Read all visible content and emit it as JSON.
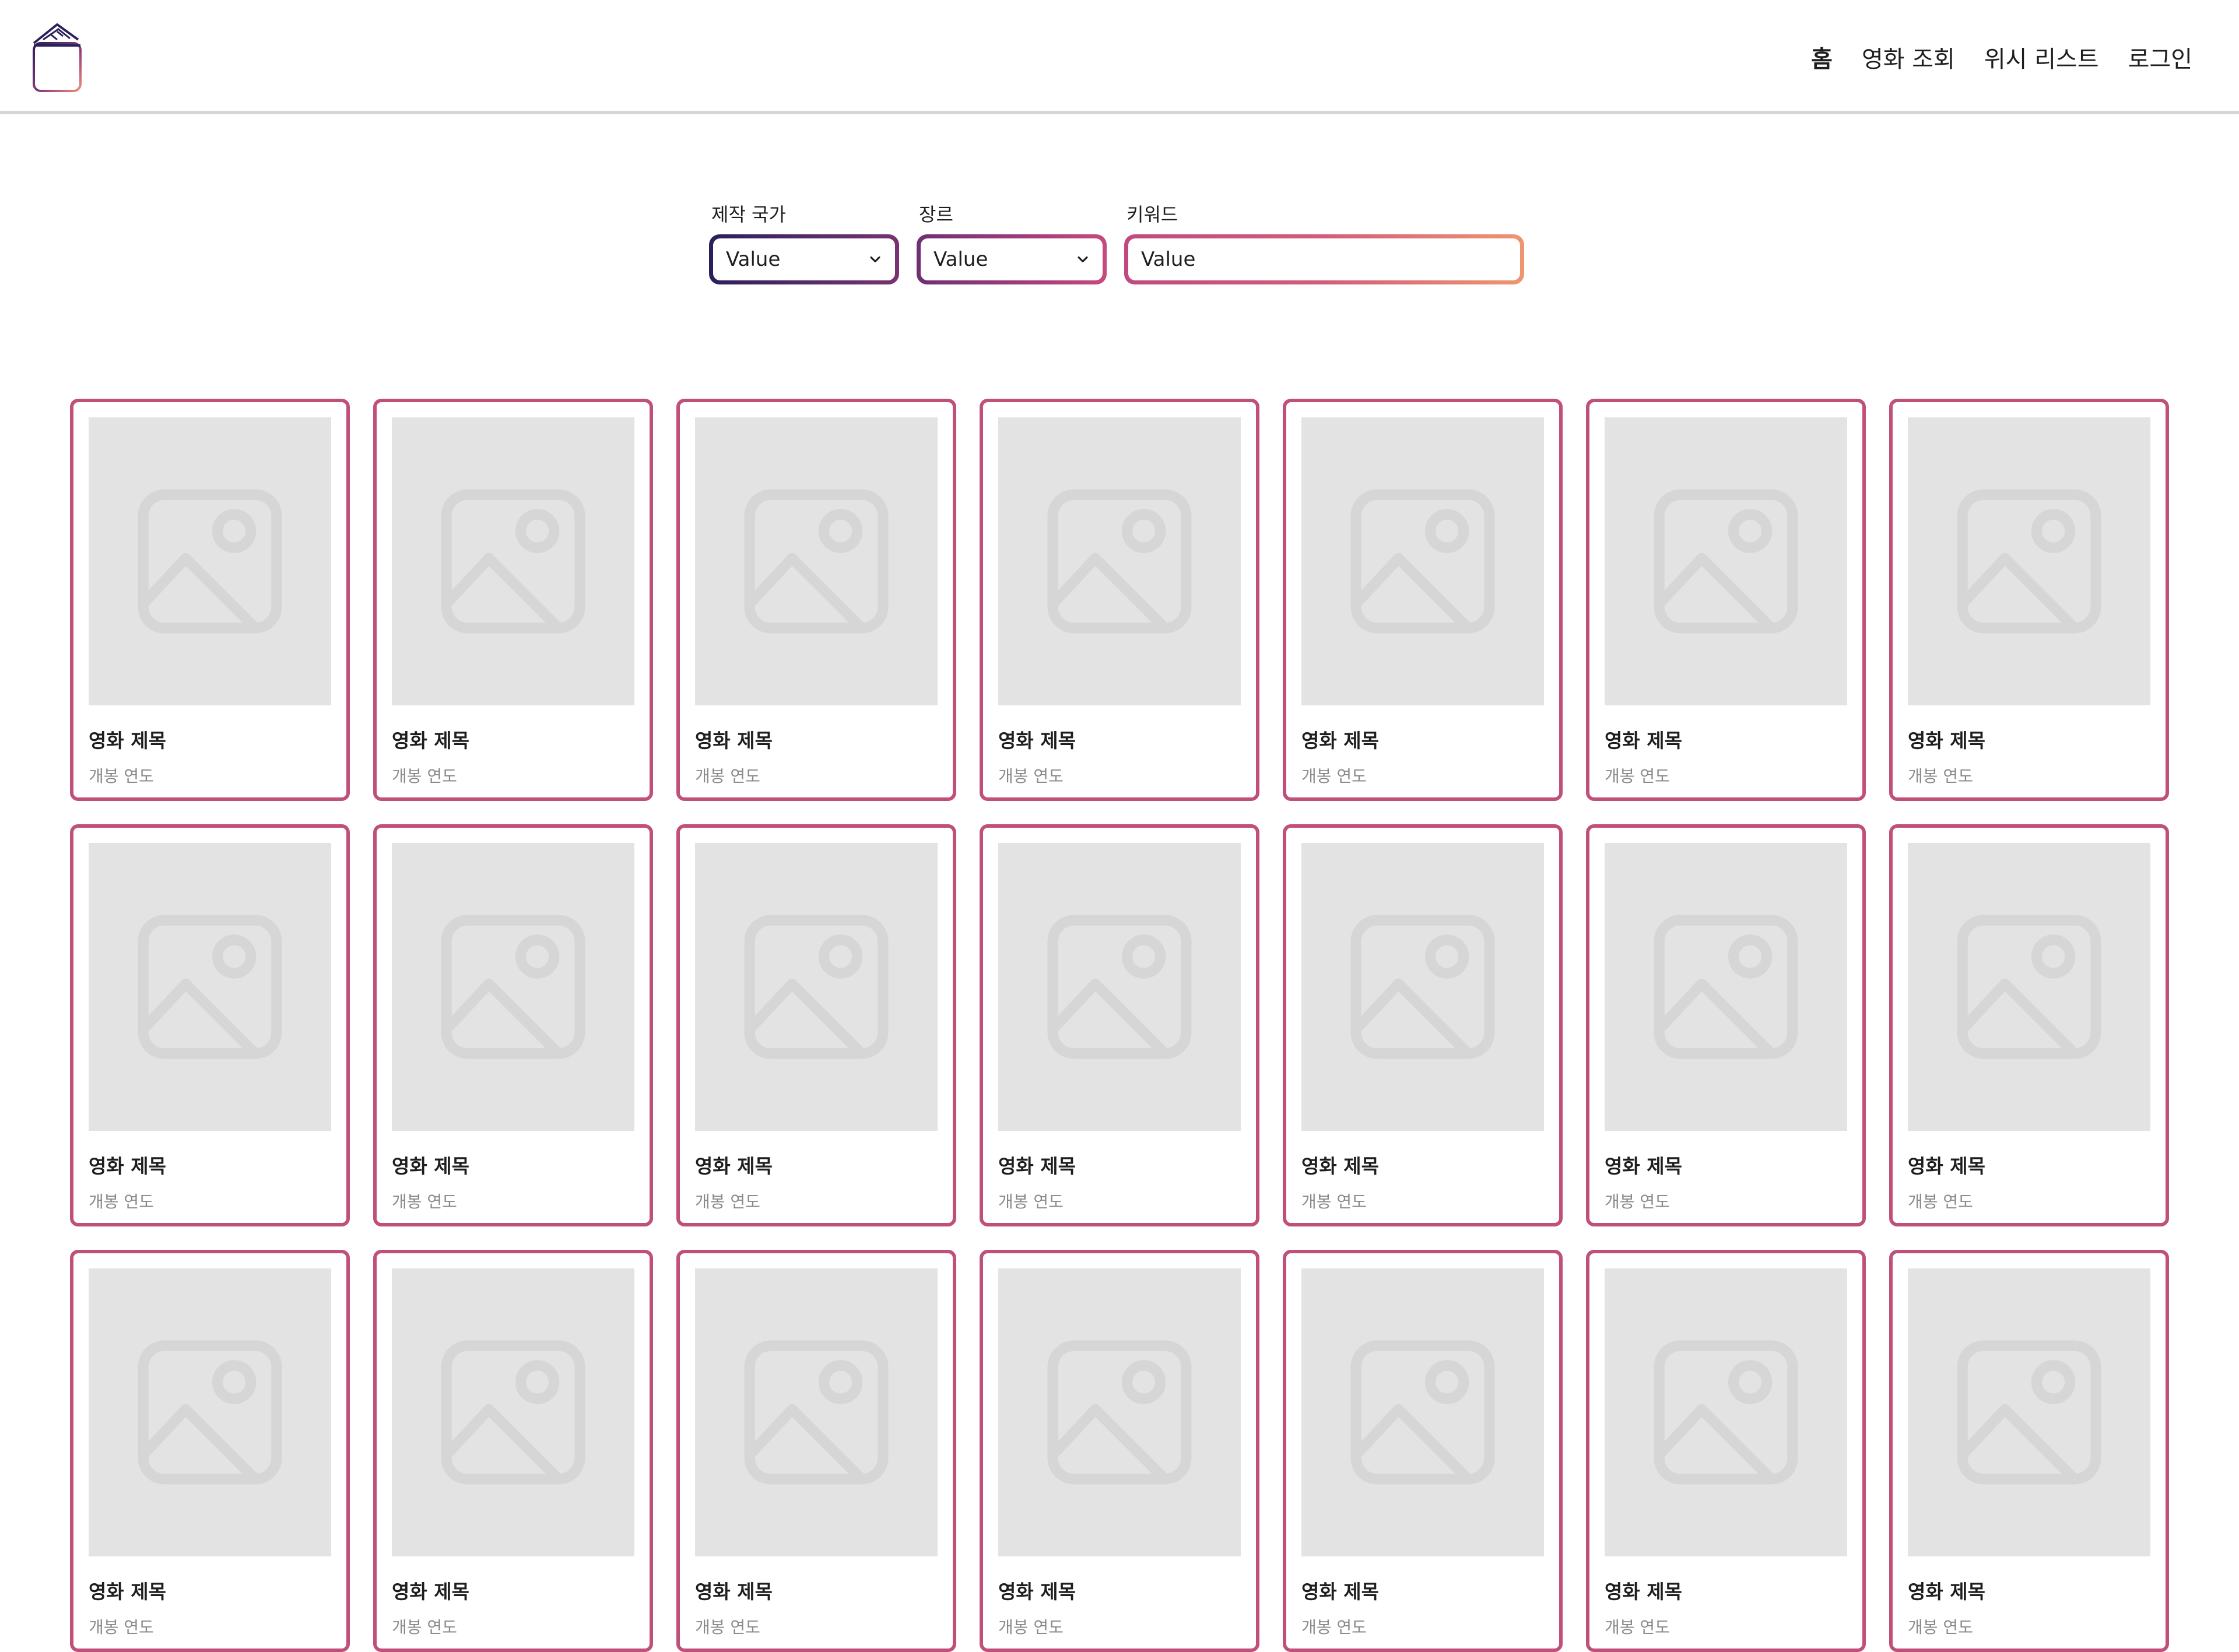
{
  "header": {
    "logo_icon": "wallet-ticket-logo-icon",
    "nav": [
      {
        "label": "홈",
        "active": true
      },
      {
        "label": "영화 조회",
        "active": false
      },
      {
        "label": "위시 리스트",
        "active": false
      },
      {
        "label": "로그인",
        "active": false
      }
    ]
  },
  "filters": {
    "country": {
      "label": "제작 국가",
      "value": "Value"
    },
    "genre": {
      "label": "장르",
      "value": "Value"
    },
    "keyword": {
      "label": "키워드",
      "value": "Value"
    }
  },
  "colors": {
    "card_border": "#c0507a",
    "placeholder_bg": "#e3e3e3",
    "gradient_start": "#2b1f5c",
    "gradient_end": "#ee9670"
  },
  "movies": [
    {
      "title": "영화 제목",
      "year": "개봉 연도",
      "image_icon": "image-placeholder-icon"
    },
    {
      "title": "영화 제목",
      "year": "개봉 연도",
      "image_icon": "image-placeholder-icon"
    },
    {
      "title": "영화 제목",
      "year": "개봉 연도",
      "image_icon": "image-placeholder-icon"
    },
    {
      "title": "영화 제목",
      "year": "개봉 연도",
      "image_icon": "image-placeholder-icon"
    },
    {
      "title": "영화 제목",
      "year": "개봉 연도",
      "image_icon": "image-placeholder-icon"
    },
    {
      "title": "영화 제목",
      "year": "개봉 연도",
      "image_icon": "image-placeholder-icon"
    },
    {
      "title": "영화 제목",
      "year": "개봉 연도",
      "image_icon": "image-placeholder-icon"
    },
    {
      "title": "영화 제목",
      "year": "개봉 연도",
      "image_icon": "image-placeholder-icon"
    },
    {
      "title": "영화 제목",
      "year": "개봉 연도",
      "image_icon": "image-placeholder-icon"
    },
    {
      "title": "영화 제목",
      "year": "개봉 연도",
      "image_icon": "image-placeholder-icon"
    },
    {
      "title": "영화 제목",
      "year": "개봉 연도",
      "image_icon": "image-placeholder-icon"
    },
    {
      "title": "영화 제목",
      "year": "개봉 연도",
      "image_icon": "image-placeholder-icon"
    },
    {
      "title": "영화 제목",
      "year": "개봉 연도",
      "image_icon": "image-placeholder-icon"
    },
    {
      "title": "영화 제목",
      "year": "개봉 연도",
      "image_icon": "image-placeholder-icon"
    },
    {
      "title": "영화 제목",
      "year": "개봉 연도",
      "image_icon": "image-placeholder-icon"
    },
    {
      "title": "영화 제목",
      "year": "개봉 연도",
      "image_icon": "image-placeholder-icon"
    },
    {
      "title": "영화 제목",
      "year": "개봉 연도",
      "image_icon": "image-placeholder-icon"
    },
    {
      "title": "영화 제목",
      "year": "개봉 연도",
      "image_icon": "image-placeholder-icon"
    },
    {
      "title": "영화 제목",
      "year": "개봉 연도",
      "image_icon": "image-placeholder-icon"
    },
    {
      "title": "영화 제목",
      "year": "개봉 연도",
      "image_icon": "image-placeholder-icon"
    },
    {
      "title": "영화 제목",
      "year": "개봉 연도",
      "image_icon": "image-placeholder-icon"
    }
  ]
}
